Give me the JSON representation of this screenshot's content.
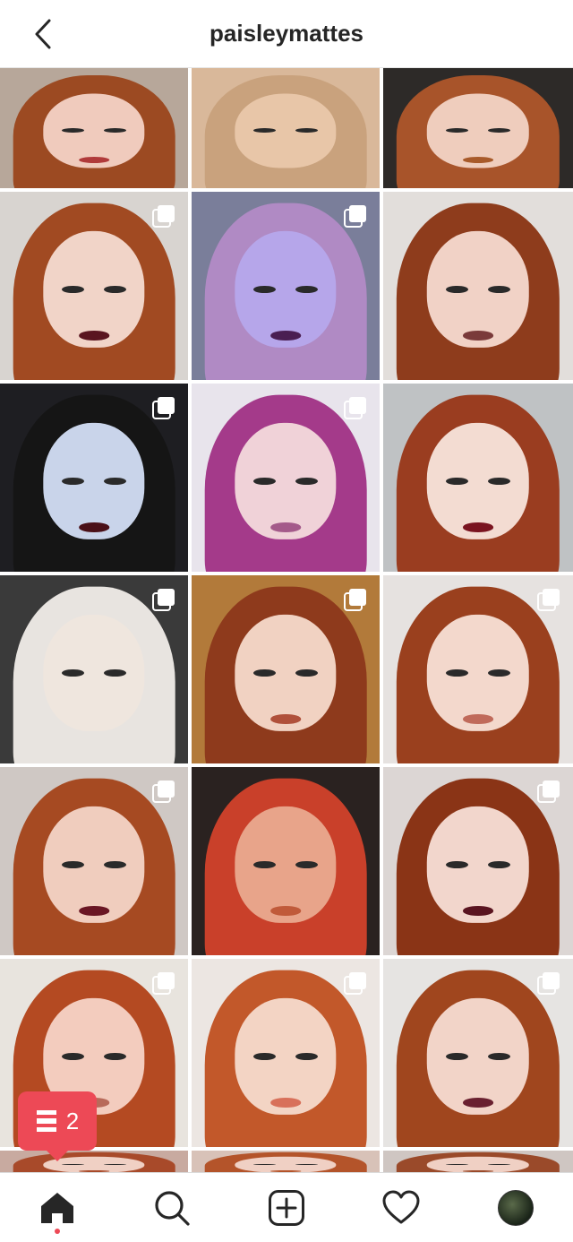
{
  "header": {
    "username": "paisleymattes"
  },
  "grid": {
    "posts": [
      {
        "theme": "redhead-band-tee",
        "multi": false,
        "bg": "#b7a79a",
        "hair": "#9c4a22",
        "skin": "#f0cbbd",
        "lips": "#b03a3a"
      },
      {
        "theme": "eye-closeup-blue-liner",
        "multi": false,
        "bg": "#d9b89a",
        "hair": "#c9a27d",
        "skin": "#e8c6a8",
        "lips": "#e8c6a8"
      },
      {
        "theme": "redhead-band-tee-2",
        "multi": false,
        "bg": "#2d2a28",
        "hair": "#a8542a",
        "skin": "#efcdbd",
        "lips": "#a85a2a"
      },
      {
        "theme": "lace-mask",
        "multi": true,
        "bg": "#d8d4d0",
        "hair": "#a14a22",
        "skin": "#f1d4c8",
        "lips": "#5a1520"
      },
      {
        "theme": "purple-moon-face",
        "multi": true,
        "bg": "#7a7e9a",
        "hair": "#b08ac4",
        "skin": "#b6a6ea",
        "lips": "#4a1e52"
      },
      {
        "theme": "smokey-eye",
        "multi": false,
        "bg": "#e2dedb",
        "hair": "#8e3c1c",
        "skin": "#f1d2c6",
        "lips": "#7a3a3a"
      },
      {
        "theme": "flame-face-paint",
        "multi": true,
        "bg": "#1e1e22",
        "hair": "#151515",
        "skin": "#c9d4ea",
        "lips": "#4a1018"
      },
      {
        "theme": "witch-hat-purple-hair",
        "multi": true,
        "bg": "#e8e4ec",
        "hair": "#a43a8a",
        "skin": "#f0d2d8",
        "lips": "#a45a8a"
      },
      {
        "theme": "glitter-eye",
        "multi": false,
        "bg": "#bfc2c4",
        "hair": "#9a3d20",
        "skin": "#f3dcd2",
        "lips": "#7a1420"
      },
      {
        "theme": "rare-beauty-products",
        "multi": true,
        "bg": "#3a3a3a",
        "hair": "#e8e4e0",
        "skin": "#efe6de",
        "lips": "#efe6de"
      },
      {
        "theme": "rainbow-light",
        "multi": true,
        "bg": "#b27a3a",
        "hair": "#8e3a1c",
        "skin": "#f1d2c2",
        "lips": "#b0503a"
      },
      {
        "theme": "purple-eyeshadow",
        "multi": true,
        "bg": "#e6e2e0",
        "hair": "#9a401e",
        "skin": "#f3d8cc",
        "lips": "#c06a5a"
      },
      {
        "theme": "freckles-berry-lip",
        "multi": true,
        "bg": "#cfc8c4",
        "hair": "#a64a22",
        "skin": "#f0cdbe",
        "lips": "#6a1624"
      },
      {
        "theme": "mac-lipsticks",
        "multi": false,
        "bg": "#2a2220",
        "hair": "#c9402a",
        "skin": "#e8a48a",
        "lips": "#c05a3a"
      },
      {
        "theme": "burgundy-lip",
        "multi": true,
        "bg": "#dcd6d4",
        "hair": "#8a3416",
        "skin": "#f2d6cc",
        "lips": "#5a1420"
      },
      {
        "theme": "brown-hat-yellow-eyes",
        "multi": true,
        "bg": "#e8e4de",
        "hair": "#b44a22",
        "skin": "#f3ccbe",
        "lips": "#b86a5a"
      },
      {
        "theme": "freckles-coral-lip",
        "multi": true,
        "bg": "#ece6e2",
        "hair": "#c2582a",
        "skin": "#f3d4c4",
        "lips": "#d8705a"
      },
      {
        "theme": "stripes-dark-lip",
        "multi": true,
        "bg": "#e6e4e2",
        "hair": "#a0461e",
        "skin": "#f2d4c8",
        "lips": "#6a2030"
      },
      {
        "theme": "partial-row",
        "multi": false,
        "bg": "#c8aaa0",
        "hair": "#a84a2a",
        "skin": "#f0d0c4",
        "lips": "#a84a2a"
      },
      {
        "theme": "partial-row",
        "multi": true,
        "bg": "#d8c2b8",
        "hair": "#b4542a",
        "skin": "#f0d0c4",
        "lips": "#b4542a"
      },
      {
        "theme": "partial-row",
        "multi": true,
        "bg": "#cfc6c2",
        "hair": "#9a4a2a",
        "skin": "#f0d0c4",
        "lips": "#9a4a2a"
      }
    ]
  },
  "notification": {
    "count": "2",
    "color": "#ed4956"
  },
  "bottom_nav": {
    "items": [
      {
        "name": "home-icon",
        "active": true
      },
      {
        "name": "search-icon",
        "active": false
      },
      {
        "name": "new-post-icon",
        "active": false
      },
      {
        "name": "activity-heart-icon",
        "active": false
      },
      {
        "name": "profile-avatar",
        "active": false
      }
    ]
  }
}
